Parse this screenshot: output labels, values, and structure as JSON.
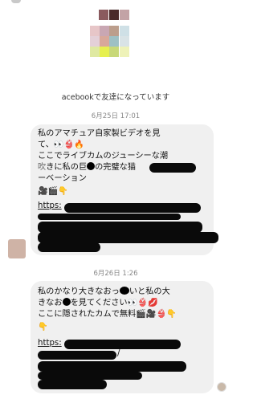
{
  "friend_notice": "acebookで友達になっています",
  "messages": [
    {
      "timestamp": "6月25日 17:01",
      "line1": "私のアマチュア自家製ビデオを見",
      "line2": "て、👀👙🔥",
      "line3": "ここでライブカムのジューシーな潮",
      "line4a": "吹",
      "line4b": "きに私の巨",
      "line4c": "の完璧な猫",
      "line5": "ーベーション",
      "line6": "🎥🎬👇",
      "link": "https:"
    },
    {
      "timestamp": "6月26日 1:26",
      "line1a": "私のかなり大きなおっ",
      "line1b": "いと私の大",
      "line2a": "きなお",
      "line2b": "を見てください👀👙💋",
      "line3": "ここに隠されたカムで無料🎬🎥👙👇",
      "line4": "👇",
      "link": "https:",
      "slash": "/"
    }
  ]
}
